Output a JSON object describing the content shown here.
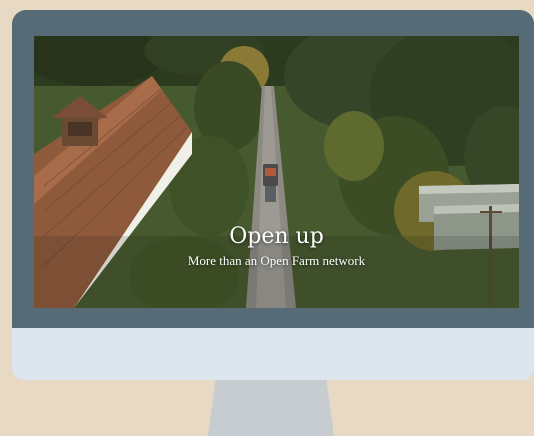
{
  "hero": {
    "title": "Open up",
    "subtitle": "More than an Open Farm network"
  },
  "colors": {
    "background": "#e7d9c3",
    "bezel": "#566b75",
    "chin": "#dde6ee",
    "stand": "#c7ccd1"
  }
}
